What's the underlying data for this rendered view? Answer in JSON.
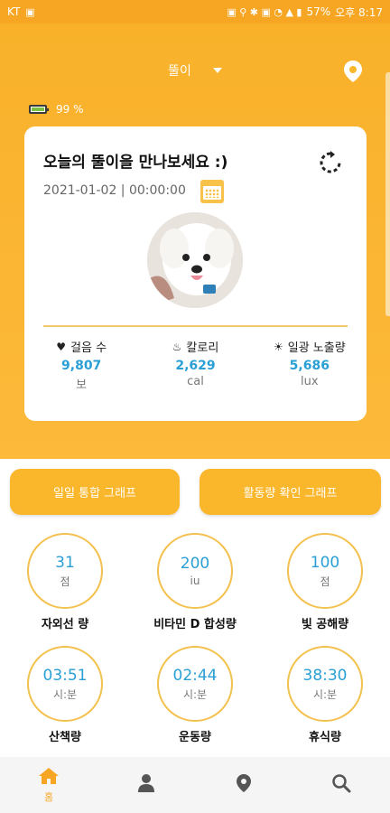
{
  "status_bar": {
    "carrier": "KT",
    "battery": "57%",
    "time": "오후 8:17"
  },
  "header": {
    "dog_name": "뚤이",
    "battery_level": "99 %"
  },
  "card": {
    "title": "오늘의 뚤이을 만나보세요 :)",
    "datetime": "2021-01-02 | 00:00:00",
    "stats": [
      {
        "icon": "heart-icon",
        "label": "걸음 수",
        "value": "9,807",
        "unit": "보"
      },
      {
        "icon": "fire-icon",
        "label": "칼로리",
        "value": "2,629",
        "unit": "cal"
      },
      {
        "icon": "sun-icon",
        "label": "일광 노출량",
        "value": "5,686",
        "unit": "lux"
      }
    ]
  },
  "buttons": {
    "daily_graph": "일일 통합 그래프",
    "activity_graph": "활동량 확인 그래프"
  },
  "metrics": [
    {
      "value": "31",
      "unit": "점",
      "label": "자외선 량"
    },
    {
      "value": "200",
      "unit": "iu",
      "label": "비타민 D 합성량"
    },
    {
      "value": "100",
      "unit": "점",
      "label": "빛 공해량"
    },
    {
      "value": "03:51",
      "unit": "시:분",
      "label": "산책량"
    },
    {
      "value": "02:44",
      "unit": "시:분",
      "label": "운동량"
    },
    {
      "value": "38:30",
      "unit": "시:분",
      "label": "휴식량"
    }
  ],
  "nav": {
    "home_label": "홈",
    "items": [
      "home-icon",
      "profile-icon",
      "location-icon",
      "search-icon"
    ]
  },
  "colors": {
    "accent": "#fbb72c",
    "value_blue": "#2a9fd6",
    "ring": "#f3c14f"
  }
}
